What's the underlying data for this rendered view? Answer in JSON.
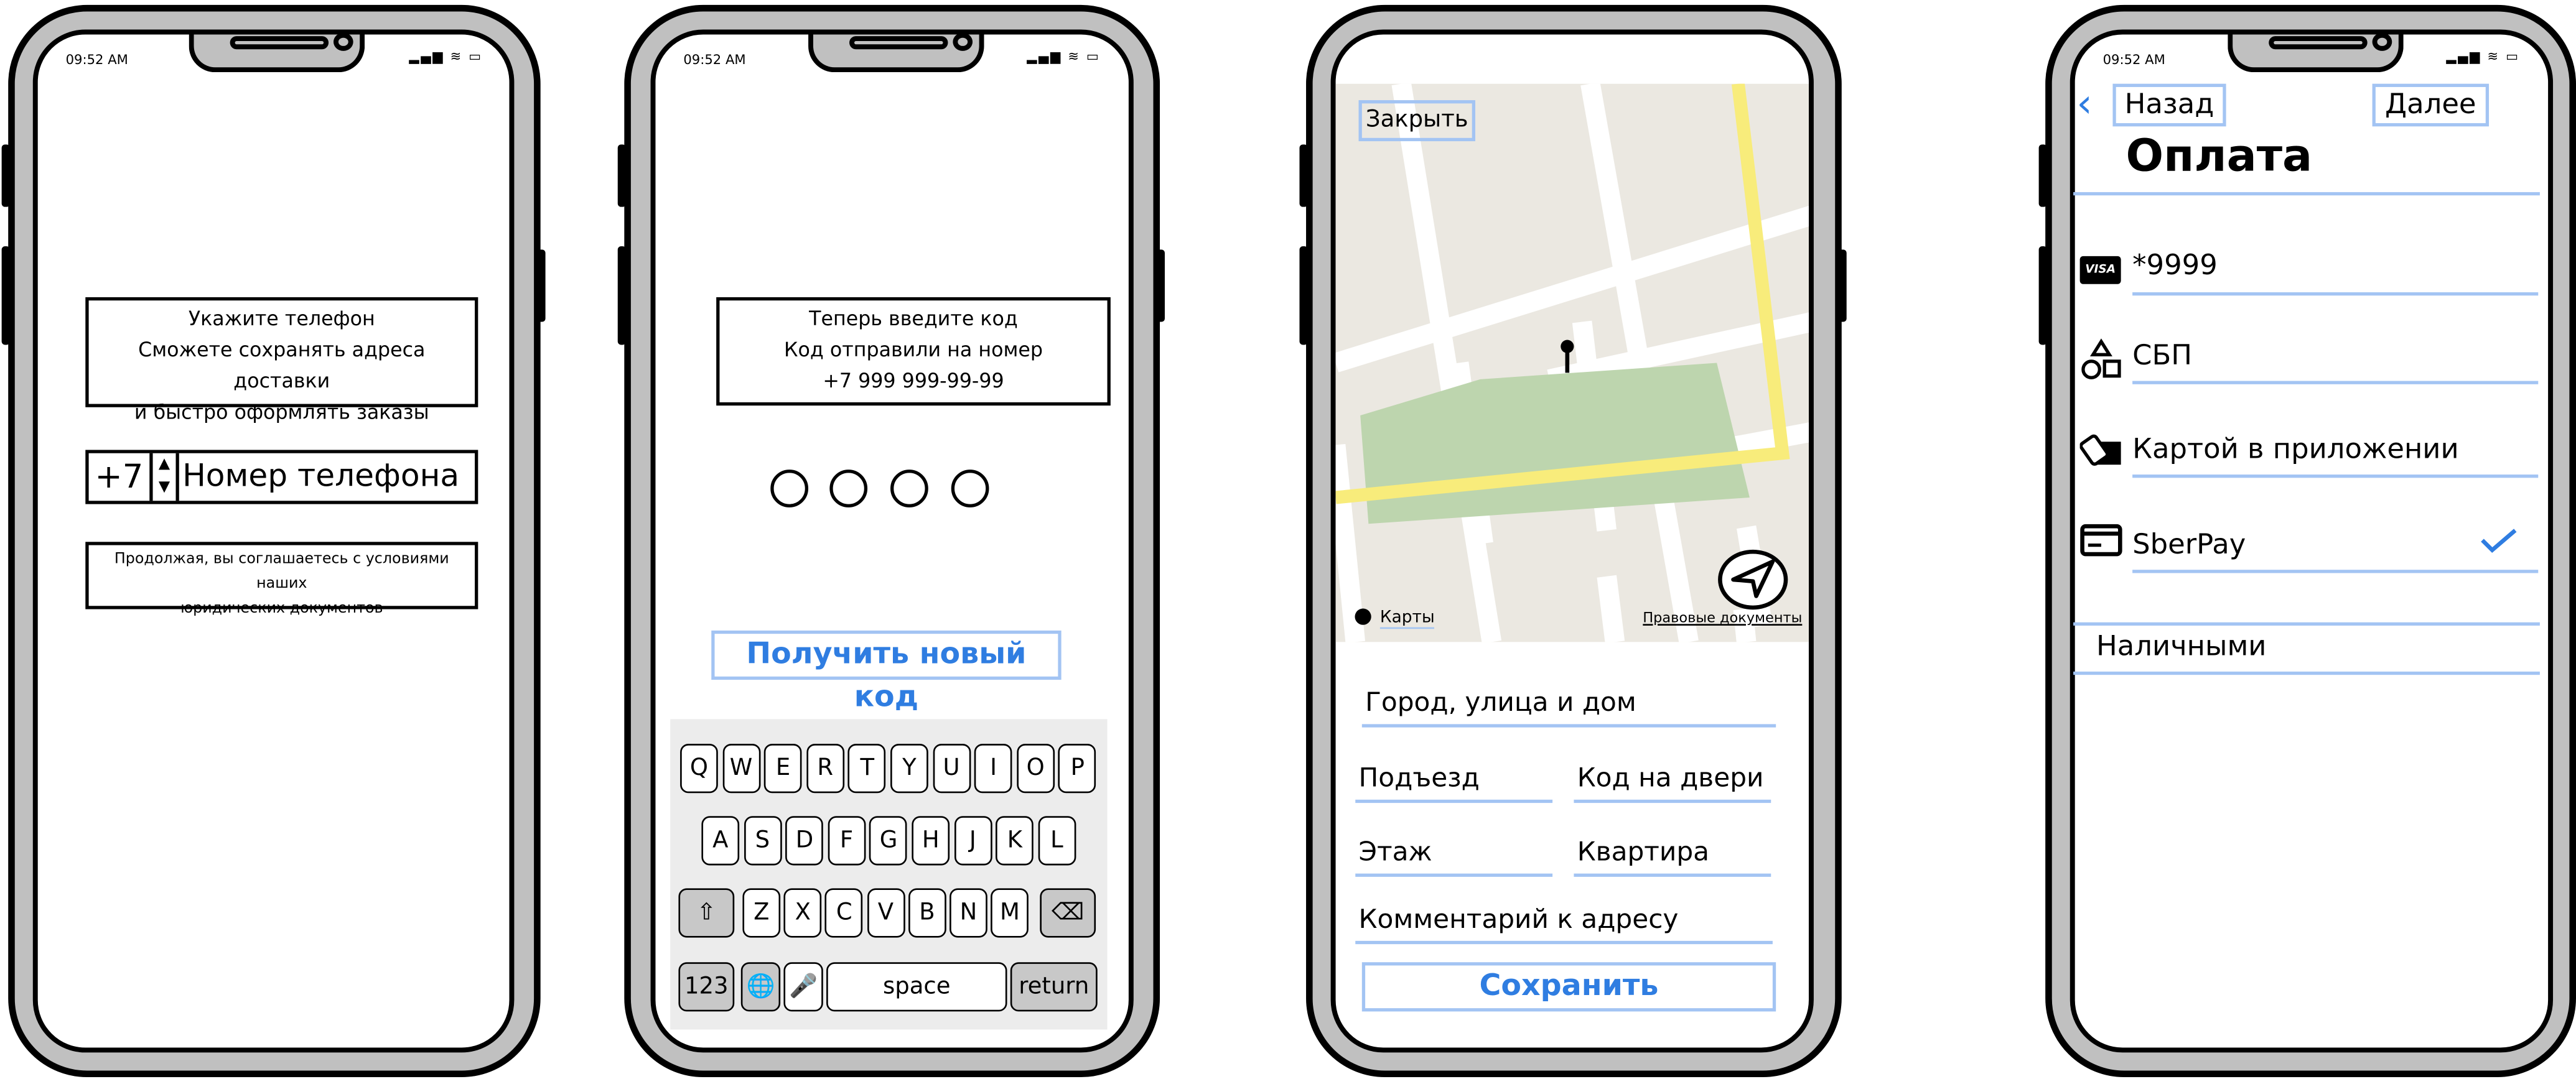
{
  "status_bar": {
    "time": "09:52 AM",
    "signal_icons": "signal wifi battery"
  },
  "screen1": {
    "info_lines": [
      "Укажите телефон",
      "Сможете сохранять адреса доставки",
      "и быстро оформлять заказы"
    ],
    "country_code": "+7",
    "phone_placeholder": "Номер телефона",
    "legal_lines": [
      "Продолжая, вы соглашаетесь с условиями наших",
      "юридических документов"
    ]
  },
  "screen2": {
    "info_lines": [
      "Теперь введите код",
      "Код отправили на номер",
      "+7 999 999-99-99"
    ],
    "code_digits": 4,
    "resend_button": "Получить новый код",
    "keyboard": {
      "row1": [
        "Q",
        "W",
        "E",
        "R",
        "T",
        "Y",
        "U",
        "I",
        "O",
        "P"
      ],
      "row2": [
        "A",
        "S",
        "D",
        "F",
        "G",
        "H",
        "J",
        "K",
        "L"
      ],
      "row3": [
        "Z",
        "X",
        "C",
        "V",
        "B",
        "N",
        "M"
      ],
      "shift": "⇧",
      "delete": "⌫",
      "numbers": "123",
      "globe": "🌐",
      "mic": "🎤",
      "space": "space",
      "return": "return"
    }
  },
  "screen3": {
    "close_button": "Закрыть",
    "maps_label": "Карты",
    "legal_link": "Правовые документы",
    "fields": {
      "address": "Город, улица и дом",
      "entrance": "Подъезд",
      "door_code": "Код на двери",
      "floor": "Этаж",
      "apartment": "Квартира",
      "comment": "Комментарий к адресу"
    },
    "save_button": "Сохранить"
  },
  "screen4": {
    "back_button": "Назад",
    "next_button": "Далее",
    "title": "Оплата",
    "methods": [
      {
        "label": "*9999",
        "icon": "visa-icon",
        "selected": false,
        "icon_text": "VISA"
      },
      {
        "label": "СБП",
        "icon": "shapes-icon",
        "selected": false
      },
      {
        "label": "Картой в приложении",
        "icon": "cards-icon",
        "selected": false
      },
      {
        "label": "SberPay",
        "icon": "credit-card-icon",
        "selected": true
      }
    ],
    "cash": "Наличными"
  },
  "colors": {
    "accent": "#2f7de1",
    "underline": "#a3c4f3",
    "frame": "#c0c0c0",
    "map_bg": "#ebe8e1",
    "park": "#bdd5ae",
    "major_road": "#f8ec7b"
  }
}
